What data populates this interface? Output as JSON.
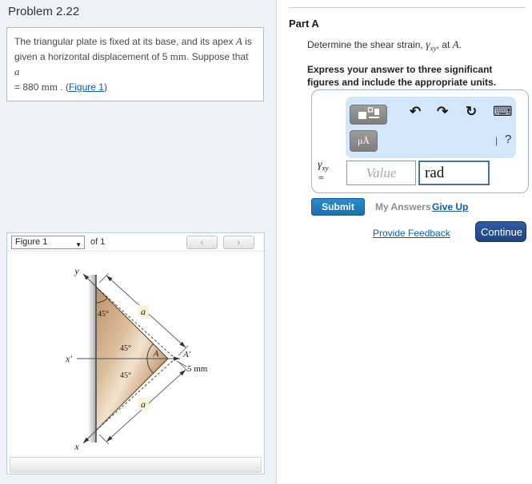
{
  "page": {
    "title": "Problem 2.22"
  },
  "problem": {
    "l1a": "The triangular plate is fixed at its base, and its apex ",
    "l1b": "A",
    "l1c": " is",
    "l2a": "given a horizontal displacement of 5 ",
    "l2b": "mm",
    "l2c": ". Suppose that ",
    "l2d": "a",
    "l3a": " = 880 ",
    "l3b": "mm",
    "l3c": " . (",
    "figure_link": "Figure 1",
    "l3d": ")"
  },
  "figure": {
    "selector_label": "Figure 1",
    "of_label": "of 1",
    "prev_glyph": "‹",
    "next_glyph": "›",
    "diagram": {
      "y_label": "y",
      "x_label": "x",
      "x_prime_label": "x′",
      "angle_top": "45°",
      "angle_upper": "45°",
      "angle_lower": "45°",
      "dim_a_top": "a",
      "dim_a_bottom": "a",
      "apex_label": "A",
      "apex_displaced_label": "A′",
      "displacement_label": "5 mm"
    }
  },
  "part_a": {
    "title": "Part A",
    "q1": "Determine the shear strain, ",
    "gamma": "γ",
    "gamma_sub": "xy",
    "q2": ", at ",
    "q3": "A",
    "q4": ".",
    "express1": "Express your answer to three significant",
    "express2": "figures and include the appropriate units."
  },
  "toolbar": {
    "undo_glyph": "↶",
    "redo_glyph": "↷",
    "reset_glyph": "↻",
    "keyboard_glyph": "⌨",
    "units_label": "μÅ",
    "separator": "|",
    "help_label": "?"
  },
  "answer": {
    "gamma": "γ",
    "gamma_sub": "xy",
    "equals": "=",
    "value_placeholder": "Value",
    "units_value": "rad"
  },
  "buttons": {
    "submit": "Submit",
    "my_answers": "My Answers",
    "give_up": "Give Up",
    "provide_feedback": "Provide Feedback",
    "continue": "Continue"
  },
  "colors": {
    "left_background": "#eef3fa",
    "toolbar_background": "#d4e6f9",
    "submit_blue": "#1d7dc4",
    "continue_navy": "#24508f",
    "link_blue": "#0c5ea9",
    "plate_copper": "#c89a72",
    "dim_label_highlight": "#fbf3d5"
  }
}
